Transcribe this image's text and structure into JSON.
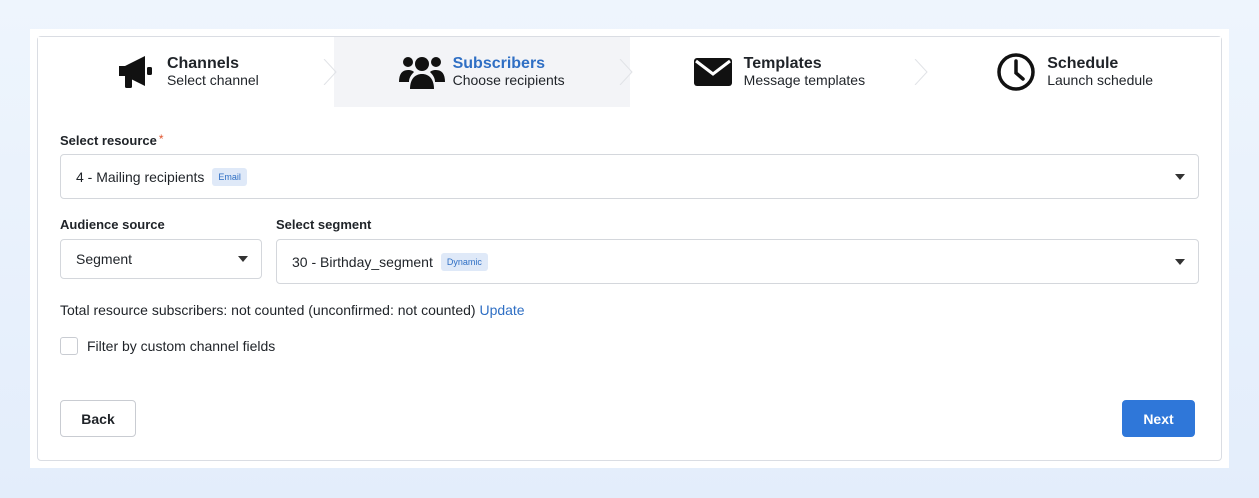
{
  "stepper": [
    {
      "title": "Channels",
      "subtitle": "Select channel",
      "icon": "megaphone-icon",
      "active": false
    },
    {
      "title": "Subscribers",
      "subtitle": "Choose recipients",
      "icon": "users-icon",
      "active": true
    },
    {
      "title": "Templates",
      "subtitle": "Message templates",
      "icon": "envelope-icon",
      "active": false
    },
    {
      "title": "Schedule",
      "subtitle": "Launch schedule",
      "icon": "clock-icon",
      "active": false
    }
  ],
  "resource": {
    "label": "Select resource",
    "required_mark": "*",
    "value": "4 - Mailing recipients",
    "badge": "Email"
  },
  "audience": {
    "label": "Audience source",
    "value": "Segment"
  },
  "segment": {
    "label": "Select segment",
    "value": "30 - Birthday_segment",
    "badge": "Dynamic"
  },
  "totals": {
    "text": "Total resource subscribers: not counted (unconfirmed: not counted)",
    "update_link": "Update"
  },
  "filter": {
    "label": "Filter by custom channel fields",
    "checked": false
  },
  "actions": {
    "back": "Back",
    "next": "Next"
  },
  "colors": {
    "accent": "#2f77d9",
    "active_step_text": "#2f6fc4",
    "active_step_bg": "#f3f4f7",
    "required": "#e0552e"
  }
}
